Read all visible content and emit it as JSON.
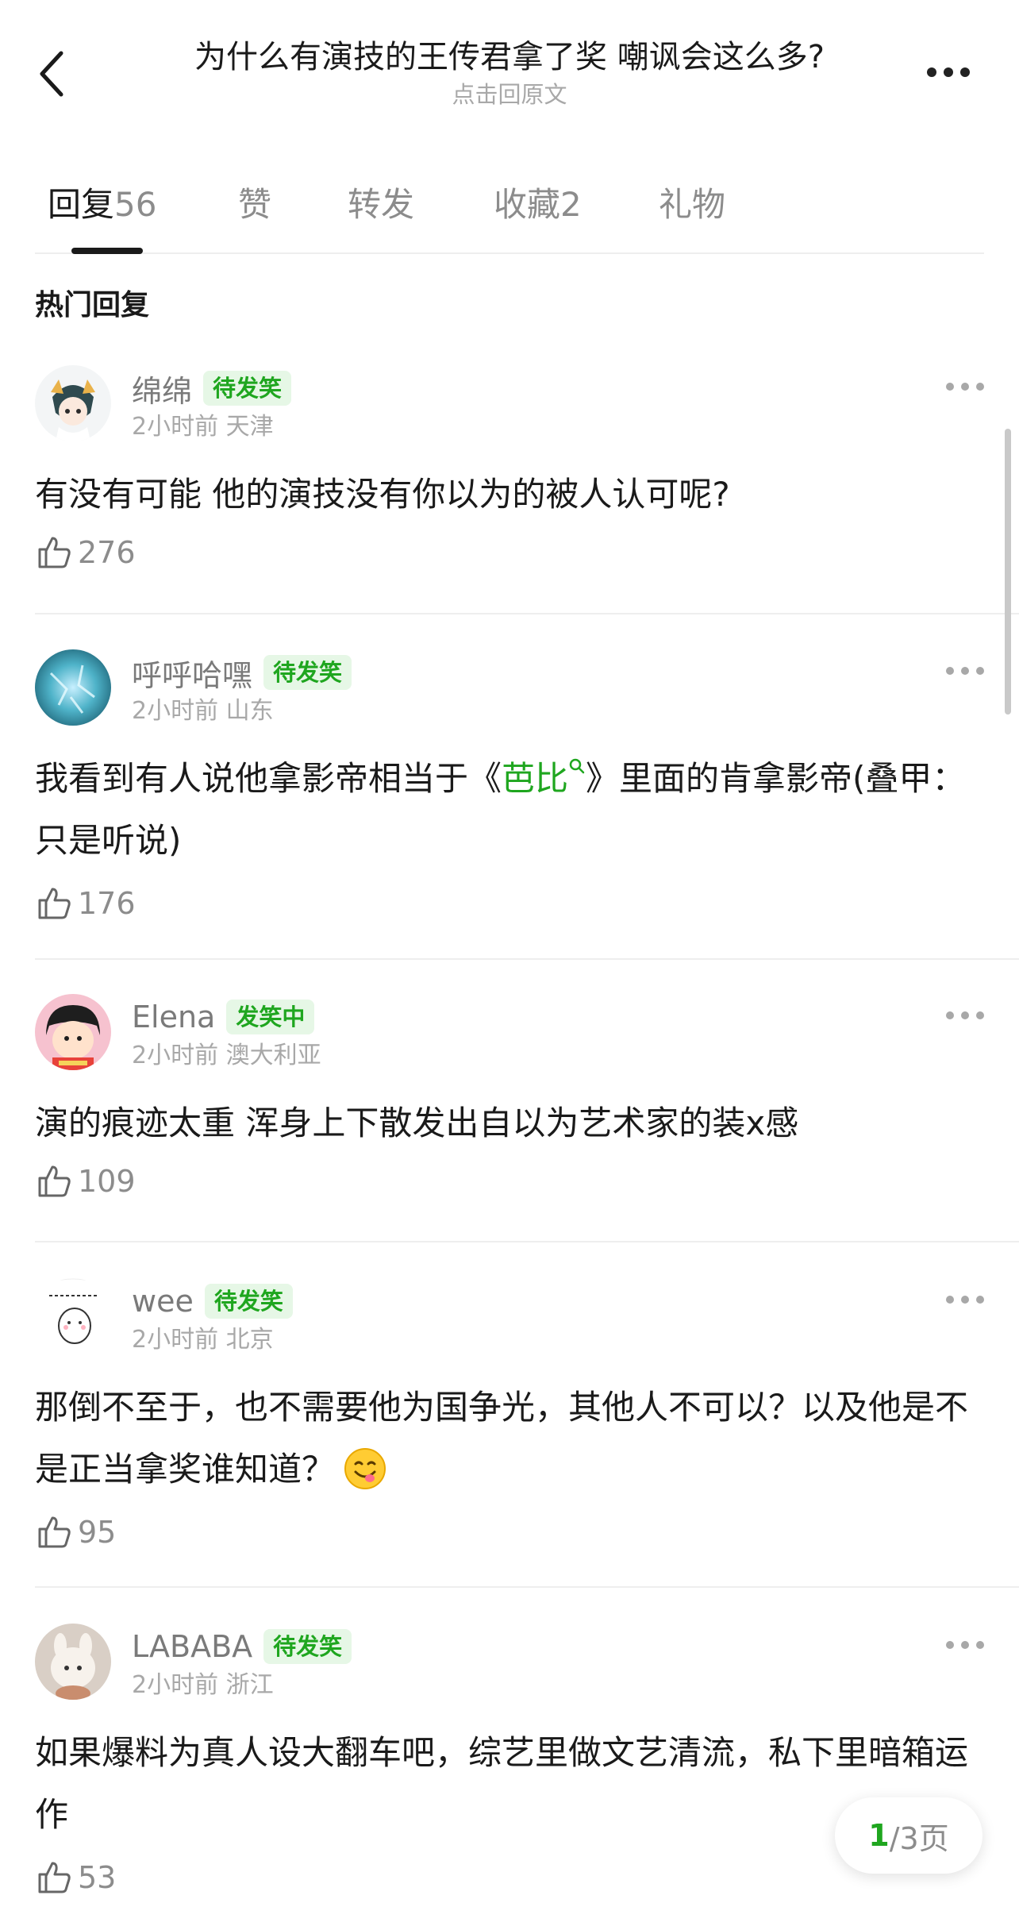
{
  "header": {
    "title": "为什么有演技的王传君拿了奖 嘲讽会这么多?",
    "subtitle": "点击回原文"
  },
  "tabs": [
    {
      "label": "回复",
      "count": "56"
    },
    {
      "label": "赞",
      "count": ""
    },
    {
      "label": "转发",
      "count": ""
    },
    {
      "label": "收藏",
      "count": "2"
    },
    {
      "label": "礼物",
      "count": ""
    }
  ],
  "section_title": "热门回复",
  "comments": [
    {
      "name": "绵绵",
      "badge": "待发笑",
      "time": "2小时前",
      "location": "天津",
      "content": "有没有可能 他的演技没有你以为的被人认可呢?",
      "likes": "276"
    },
    {
      "name": "呼呼哈嘿",
      "badge": "待发笑",
      "time": "2小时前",
      "location": "山东",
      "content_before": "我看到有人说他拿影帝相当于《",
      "content_link": "芭比",
      "content_after": "》里面的肯拿影帝(叠甲：只是听说)",
      "likes": "176"
    },
    {
      "name": "Elena",
      "badge": "发笑中",
      "time": "2小时前",
      "location": "澳大利亚",
      "content": "演的痕迹太重 浑身上下散发出自以为艺术家的装x感",
      "likes": "109"
    },
    {
      "name": "wee",
      "badge": "待发笑",
      "time": "2小时前",
      "location": "北京",
      "content": "那倒不至于，也不需要他为国争光，其他人不可以？以及他是不是正当拿奖谁知道？",
      "likes": "95"
    },
    {
      "name": "LABABA",
      "badge": "待发笑",
      "time": "2小时前",
      "location": "浙江",
      "content": "如果爆料为真人设大翻车吧，综艺里做文艺清流，私下里暗箱运作",
      "likes": "53"
    }
  ],
  "pagination": {
    "current": "1",
    "total": "/3页"
  },
  "colors": {
    "accent_green": "#1fa61f",
    "badge_bg": "#e6f7e6",
    "text_gray": "#8c8c8c"
  }
}
